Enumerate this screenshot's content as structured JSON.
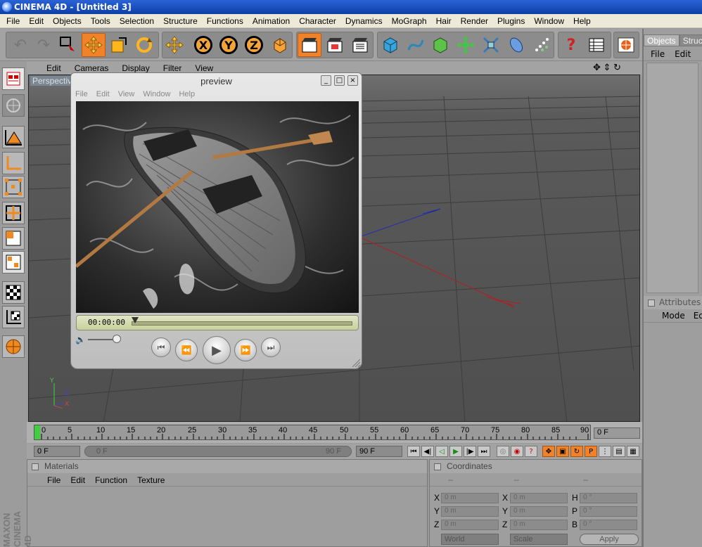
{
  "window": {
    "title": "CINEMA 4D - [Untitled 3]"
  },
  "menubar": {
    "items": [
      "File",
      "Edit",
      "Objects",
      "Tools",
      "Selection",
      "Structure",
      "Functions",
      "Animation",
      "Character",
      "Dynamics",
      "MoGraph",
      "Hair",
      "Render",
      "Plugins",
      "Window",
      "Help"
    ]
  },
  "viewport": {
    "menu": [
      "Edit",
      "Cameras",
      "Display",
      "Filter",
      "View"
    ],
    "label": "Perspective",
    "axes": {
      "y": "Y",
      "z": "Z",
      "x": "X"
    }
  },
  "preview": {
    "title": "preview",
    "menu": [
      "File",
      "Edit",
      "View",
      "Window",
      "Help"
    ],
    "timecode": "00:00:00",
    "controls": {
      "minimize": "_",
      "maximize": "□",
      "close": "×"
    }
  },
  "objects_panel": {
    "tabs": [
      "Objects",
      "Structu"
    ],
    "menu": [
      "File",
      "Edit"
    ]
  },
  "attributes_panel": {
    "title": "Attributes",
    "menu": [
      "Mode",
      "Edit"
    ]
  },
  "timeline": {
    "ticks": [
      "0",
      "5",
      "10",
      "15",
      "20",
      "25",
      "30",
      "35",
      "40",
      "45",
      "50",
      "55",
      "60",
      "65",
      "70",
      "75",
      "80",
      "85",
      "90"
    ],
    "current_frame": "0 F",
    "start_frame": "0 F",
    "range_start": "0 F",
    "range_end": "90 F",
    "end_frame": "90 F"
  },
  "materials": {
    "title": "Materials",
    "menu": [
      "File",
      "Edit",
      "Function",
      "Texture"
    ]
  },
  "coordinates": {
    "title": "Coordinates",
    "col_heads": [
      "–",
      "–",
      "–"
    ],
    "rows": [
      {
        "a": "X",
        "av": "0 m",
        "b": "X",
        "bv": "0 m",
        "c": "H",
        "cv": "0 °"
      },
      {
        "a": "Y",
        "av": "0 m",
        "b": "Y",
        "bv": "0 m",
        "c": "P",
        "cv": "0 °"
      },
      {
        "a": "Z",
        "av": "0 m",
        "b": "Z",
        "bv": "0 m",
        "c": "B",
        "cv": "0 °"
      }
    ],
    "world": "World",
    "scale": "Scale",
    "apply": "Apply"
  },
  "brand": "MAXON CINEMA 4D",
  "colors": {
    "accent": "#f0822a",
    "viewport_bg": "#575757",
    "titlebar": "#0d3ea8"
  }
}
